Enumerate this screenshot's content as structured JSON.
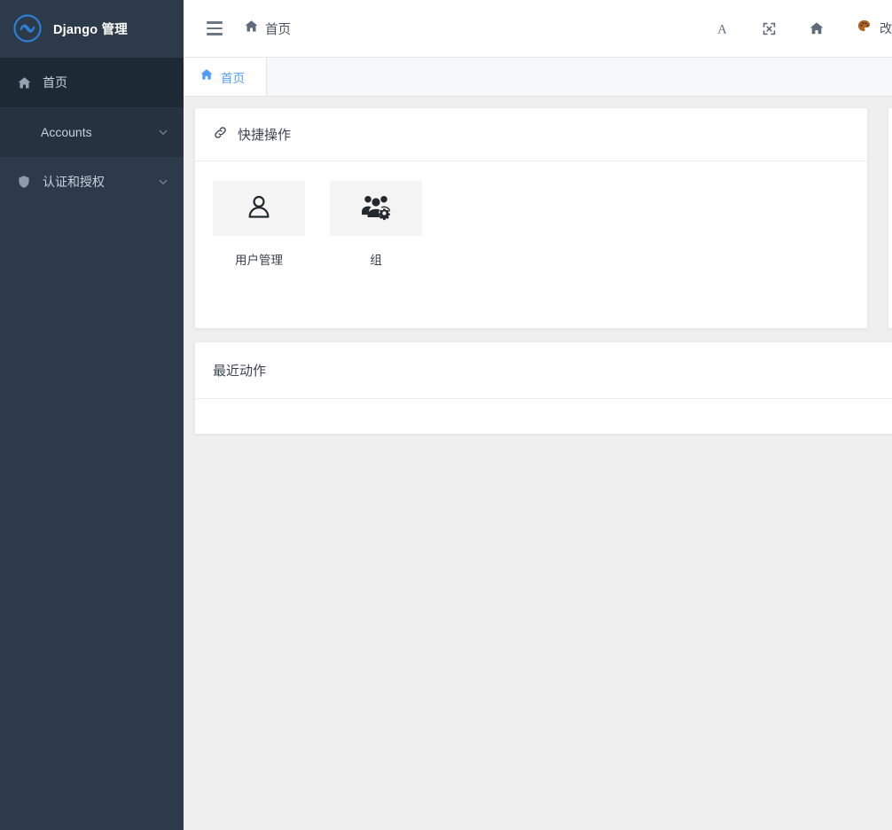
{
  "sidebar": {
    "brand": {
      "title": "Django 管理",
      "logo_icon": "infinity-circle-icon"
    },
    "items": [
      {
        "label": "首页",
        "icon": "home-icon",
        "active": true,
        "has_chevron": false
      },
      {
        "label": "Accounts",
        "icon": "",
        "active": false,
        "has_chevron": true
      },
      {
        "label": "认证和授权",
        "icon": "shield-icon",
        "active": false,
        "has_chevron": true
      }
    ]
  },
  "topbar": {
    "menu_icon": "hamburger-icon",
    "home_label": "首页",
    "home_icon": "home-icon",
    "icons": [
      {
        "name": "font-size-icon",
        "glyph": "A"
      },
      {
        "name": "fullscreen-icon",
        "glyph": ""
      },
      {
        "name": "home-icon",
        "glyph": ""
      }
    ],
    "theme": {
      "icon": "palette-icon",
      "label": "改"
    }
  },
  "tabs": [
    {
      "label": "首页",
      "icon": "home-icon",
      "active": true
    }
  ],
  "quick_actions": {
    "title": "快捷操作",
    "icon": "link-icon",
    "tiles": [
      {
        "label": "用户管理",
        "icon": "user-icon"
      },
      {
        "label": "组",
        "icon": "users-gear-icon"
      }
    ]
  },
  "recent_actions": {
    "title": "最近动作",
    "items": []
  },
  "colors": {
    "sidebar_bg": "#2c3a49",
    "sidebar_active": "#1e2936",
    "sidebar_sub": "#26323f",
    "accent": "#4f9cf5",
    "content_bg": "#efefef",
    "card_bg": "#ffffff",
    "tile_bg": "#f5f5f5"
  }
}
